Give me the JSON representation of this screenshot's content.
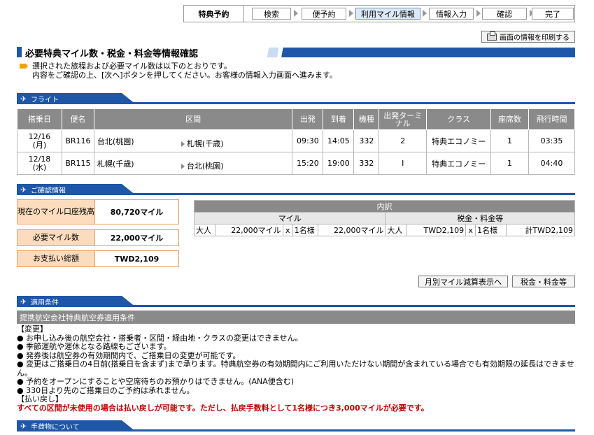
{
  "steps": {
    "title": "特典予約",
    "items": [
      "検索",
      "便予約",
      "利用マイル情報",
      "情報入力",
      "確認",
      "完了"
    ],
    "active_index": 2
  },
  "print_button": "画面の情報を印刷する",
  "page_heading": "必要特典マイル数・税金・料金等情報確認",
  "intro": [
    "選択された旅程および必要マイル数は以下のとおりです。",
    "内容をご確認の上、[次へ]ボタンを押してください。お客様の情報入力画面へ進みます。"
  ],
  "flight_section": "フライト",
  "flight_table": {
    "headers": [
      "搭乗日",
      "便名",
      "区間",
      "出発",
      "到着",
      "機種",
      "出発ターミナル",
      "クラス",
      "座席数",
      "飛行時間"
    ],
    "rows": [
      {
        "date": "12/16",
        "dow": "(月)",
        "flight": "BR116",
        "from": "台北(桃園)",
        "to": "札幌(千歳)",
        "dep": "09:30",
        "arr": "14:05",
        "aircraft": "332",
        "terminal": "2",
        "class": "特典エコノミー",
        "seats": "1",
        "duration": "03:35"
      },
      {
        "date": "12/18",
        "dow": "(水)",
        "flight": "BR115",
        "from": "札幌(千歳)",
        "to": "台北(桃園)",
        "dep": "15:20",
        "arr": "19:00",
        "aircraft": "332",
        "terminal": "I",
        "class": "特典エコノミー",
        "seats": "1",
        "duration": "04:40"
      }
    ]
  },
  "confirm_section": "ご確認情報",
  "confirm": {
    "balance_label": "現在のマイル口座残高",
    "balance_value": "80,720マイル",
    "required_label": "必要マイル数",
    "required_value": "22,000マイル",
    "payment_label": "お支払い総額",
    "payment_value": "TWD2,109"
  },
  "breakdown": {
    "title": "内訳",
    "miles_header": "マイル",
    "tax_header": "税金・料金等",
    "pax": "大人",
    "miles_unit": "22,000マイル",
    "times": "x",
    "count": "1名様",
    "miles_total": "22,000マイル",
    "tax_pax": "大人",
    "tax_unit": "TWD2,109",
    "tax_count": "1名様",
    "tax_total": "計TWD2,109"
  },
  "buttons": {
    "monthly": "月別マイル減算表示へ",
    "tax": "税金・料金等"
  },
  "conditions_section": "適用条件",
  "conditions_title": "提携航空会社特典航空券適用条件",
  "conditions": {
    "change_heading": "【変更】",
    "change_items": [
      "● お申し込み後の航空会社・搭乗者・区間・経由地・クラスの変更はできません。",
      "● 季節運航や運休となる路線もございます。",
      "● 発券後は航空券の有効期間内で、ご搭乗日の変更が可能です。",
      "● 変更はご搭乗日の4日前(搭乗日を含まず)まで承ります。特典航空券の有効期間内にご利用いただけない期間が含まれている場合でも有効期限の延長はできません。",
      "● 予約をオープンにすることや空席待ちのお預かりはできません。(ANA便含む)",
      "● 330日より先のご搭乗日のご予約は承れません。"
    ],
    "refund_heading": "【払い戻し】",
    "refund_text": "すべての区間が未使用の場合は払い戻しが可能です。ただし、払戻手数料として1名様につき3,000マイルが必要です。"
  },
  "baggage_section": "手荷物について"
}
